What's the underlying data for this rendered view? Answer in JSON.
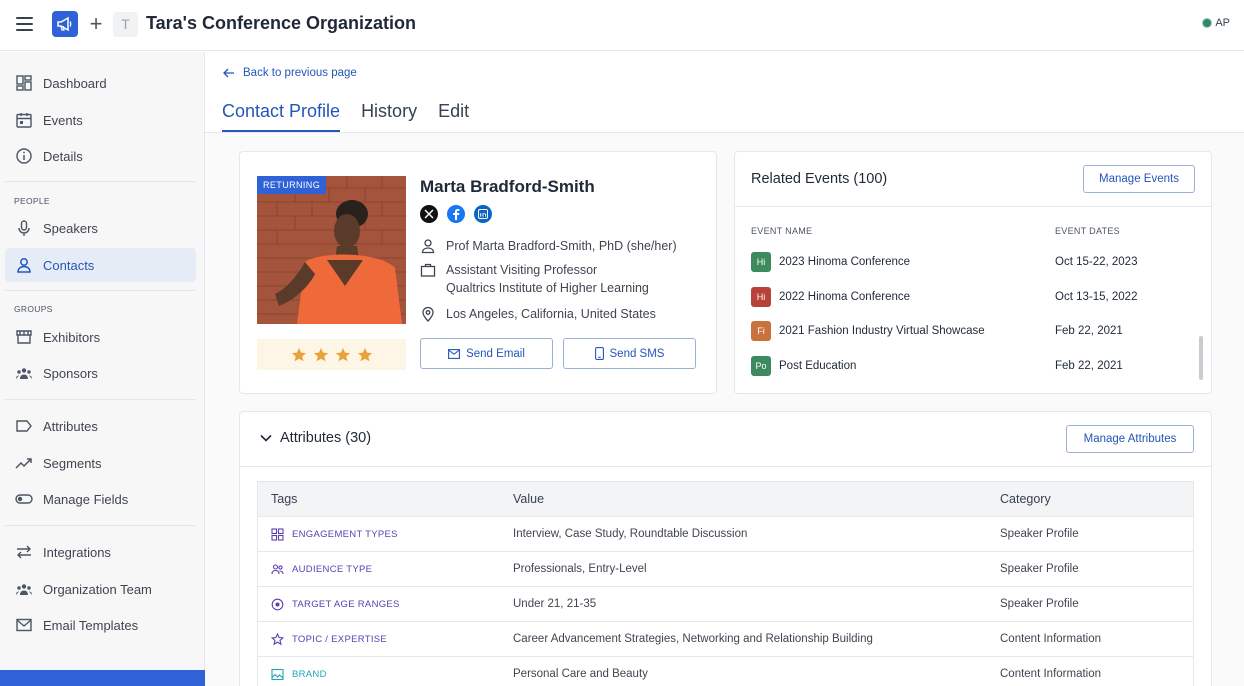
{
  "app": {
    "org_initial": "T",
    "org_title": "Tara's Conference Organization",
    "user_initials": "AP",
    "status_color": "#2b8a6f",
    "accent": "#2456b8"
  },
  "sidebar": {
    "items": [
      {
        "label": "Dashboard",
        "icon": "dashboard-icon"
      },
      {
        "label": "Events",
        "icon": "calendar-icon"
      },
      {
        "label": "Details",
        "icon": "info-icon"
      }
    ],
    "people_section": "PEOPLE",
    "people": [
      {
        "label": "Speakers",
        "icon": "microphone-icon"
      },
      {
        "label": "Contacts",
        "icon": "person-icon",
        "active": true
      }
    ],
    "groups_section": "GROUPS",
    "groups": [
      {
        "label": "Exhibitors",
        "icon": "storefront-icon"
      },
      {
        "label": "Sponsors",
        "icon": "group-icon"
      }
    ],
    "data_items": [
      {
        "label": "Attributes",
        "icon": "tag-icon"
      },
      {
        "label": "Segments",
        "icon": "trend-icon"
      },
      {
        "label": "Manage Fields",
        "icon": "toggle-icon"
      }
    ],
    "admin_items": [
      {
        "label": "Integrations",
        "icon": "arrows-icon"
      },
      {
        "label": "Organization Team",
        "icon": "team-icon"
      },
      {
        "label": "Email Templates",
        "icon": "mail-icon"
      }
    ]
  },
  "page": {
    "back_label": "Back to previous page",
    "tabs": [
      "Contact Profile",
      "History",
      "Edit"
    ],
    "active_tab": "Contact Profile"
  },
  "profile": {
    "badge": "RETURNING",
    "name": "Marta Bradford-Smith",
    "rating": 4,
    "socials": [
      "x-icon",
      "facebook-icon",
      "linkedin-icon"
    ],
    "full_name": "Prof Marta Bradford-Smith, PhD (she/her)",
    "job_title": "Assistant Visiting Professor",
    "organization": "Qualtrics Institute of Higher Learning",
    "location": "Los Angeles, California, United States",
    "send_email": "Send Email",
    "send_sms": "Send SMS"
  },
  "related_events": {
    "title": "Related Events (100)",
    "manage_label": "Manage Events",
    "col_name": "EVENT NAME",
    "col_dates": "EVENT DATES",
    "rows": [
      {
        "badge": "Hi",
        "color": "#3d8a5f",
        "name": "2023 Hinoma Conference",
        "dates": "Oct 15-22, 2023"
      },
      {
        "badge": "Hi",
        "color": "#b8423a",
        "name": "2022 Hinoma Conference",
        "dates": "Oct 13-15, 2022"
      },
      {
        "badge": "Fi",
        "color": "#c9723c",
        "name": "2021 Fashion Industry Virtual Showcase",
        "dates": "Feb 22, 2021"
      },
      {
        "badge": "Po",
        "color": "#3d8a5f",
        "name": "Post Education",
        "dates": "Feb 22, 2021"
      }
    ]
  },
  "attributes": {
    "title": "Attributes (30)",
    "manage_label": "Manage Attributes",
    "columns": [
      "Tags",
      "Value",
      "Category"
    ],
    "rows": [
      {
        "tag": "ENGAGEMENT TYPES",
        "icon": "grid-icon",
        "value": "Interview, Case Study, Roundtable Discussion",
        "category": "Speaker Profile"
      },
      {
        "tag": "AUDIENCE TYPE",
        "icon": "people-icon",
        "value": "Professionals, Entry-Level",
        "category": "Speaker Profile"
      },
      {
        "tag": "TARGET AGE RANGES",
        "icon": "target-icon",
        "value": "Under 21, 21-35",
        "category": "Speaker Profile"
      },
      {
        "tag": "TOPIC / EXPERTISE",
        "icon": "star-icon",
        "value": "Career Advancement Strategies, Networking and Relationship Building",
        "category": "Content Information"
      },
      {
        "tag": "BRAND",
        "icon": "image-icon",
        "value": "Personal Care and Beauty",
        "category": "Content Information"
      }
    ]
  }
}
